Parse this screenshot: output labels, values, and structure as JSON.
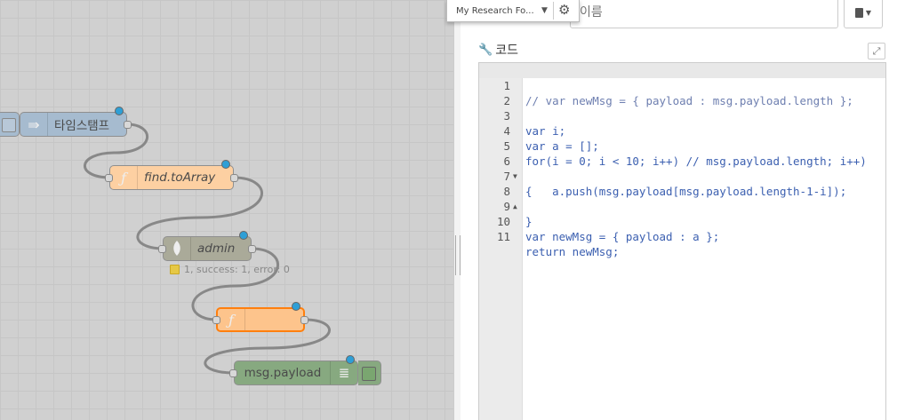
{
  "flow": {
    "nodes": {
      "timestamp": {
        "label": "타임스탬프"
      },
      "find_to_array": {
        "label": "find.toArray"
      },
      "admin": {
        "label": "admin"
      },
      "function": {
        "label": ""
      },
      "debug": {
        "label": "msg.payload"
      }
    },
    "status_text": "1, success: 1, error: 0"
  },
  "editor_panel": {
    "folder_select": {
      "value": "My Research Fo..."
    },
    "name_field": {
      "placeholder": "이름"
    },
    "code_label": "코드",
    "code_lines": [
      "// var newMsg = { payload : msg.payload.length };",
      "",
      "var i;",
      "var a = [];",
      "for(i = 0; i < 10; i++) // msg.payload.length; i++)",
      "{",
      "    a.push(msg.payload[msg.payload.length-1-i]);",
      "}",
      "",
      "var newMsg = { payload : a };",
      "return newMsg;"
    ]
  },
  "colors": {
    "inject": "#a6bbcf",
    "function": "#fdd0a2",
    "mongodb": "#aaaa99",
    "debug": "#87a980",
    "changed_dot": "#2e9fd6"
  }
}
